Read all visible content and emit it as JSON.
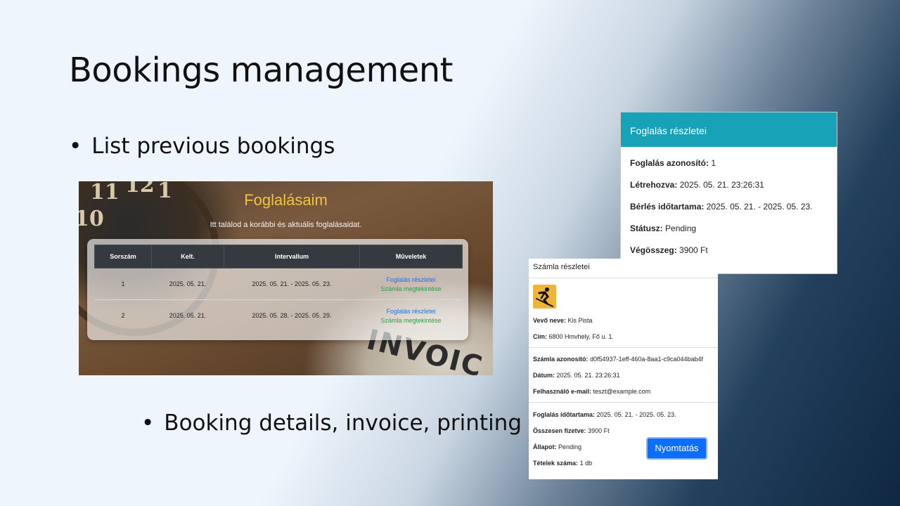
{
  "slide": {
    "title": "Bookings management",
    "bullets": [
      "List previous bookings",
      "Booking details, invoice, printing"
    ]
  },
  "bookings_list": {
    "title": "Foglalásaim",
    "subtitle": "Itt találod a korábbi és aktuális foglalásaidat.",
    "background_text": "INVOIC",
    "clock_numbers": [
      "11",
      "12",
      "1",
      "10"
    ],
    "columns": [
      "Sorszám",
      "Kelt.",
      "Intervallum",
      "Műveletek"
    ],
    "rows": [
      {
        "num": "1",
        "date": "2025. 05. 21.",
        "interval": "2025. 05. 21. - 2025. 05. 23.",
        "details_link": "Foglalás részletei",
        "invoice_link": "Számla megtekintése"
      },
      {
        "num": "2",
        "date": "2025. 05. 21.",
        "interval": "2025. 05. 28. - 2025. 05. 29.",
        "details_link": "Foglalás részletei",
        "invoice_link": "Számla megtekintése"
      }
    ],
    "colors": {
      "title": "#f3c33a",
      "header_bg": "#343a40",
      "details_link": "#1a73e8",
      "invoice_link": "#2e9e44"
    }
  },
  "booking_details": {
    "header": "Foglalás részletei",
    "header_color": "#17a2b8",
    "fields": [
      {
        "label": "Foglalás azonosító:",
        "value": "1"
      },
      {
        "label": "Létrehozva:",
        "value": "2025. 05. 21. 23:26:31"
      },
      {
        "label": "Bérlés időtartama:",
        "value": "2025. 05. 21. - 2025. 05. 23."
      },
      {
        "label": "Státusz:",
        "value": "Pending"
      },
      {
        "label": "Végösszeg:",
        "value": "3900 Ft"
      }
    ]
  },
  "invoice": {
    "header": "Számla részletei",
    "logo_icon": "skier-icon",
    "customer": [
      {
        "label": "Vevő neve:",
        "value": "Kis Pista"
      },
      {
        "label": "Cím:",
        "value": "6800 Hmvhely, Fő u. 1."
      }
    ],
    "meta": [
      {
        "label": "Számla azonosító:",
        "value": "d0f54937-1eff-460a-8aa1-c9ca044bab4f"
      },
      {
        "label": "Dátum:",
        "value": "2025. 05. 21. 23:26:31"
      },
      {
        "label": "Felhasználó e-mail:",
        "value": "teszt@example.com"
      }
    ],
    "summary": [
      {
        "label": "Foglalás időtartama:",
        "value": "2025. 05. 21. - 2025. 05. 23."
      },
      {
        "label": "Összesen fizetve:",
        "value": "3900 Ft"
      },
      {
        "label": "Állapot:",
        "value": "Pending"
      },
      {
        "label": "Tételek száma:",
        "value": "1 db"
      }
    ],
    "print_button": "Nyomtatás",
    "print_button_color": "#0d6efd"
  }
}
